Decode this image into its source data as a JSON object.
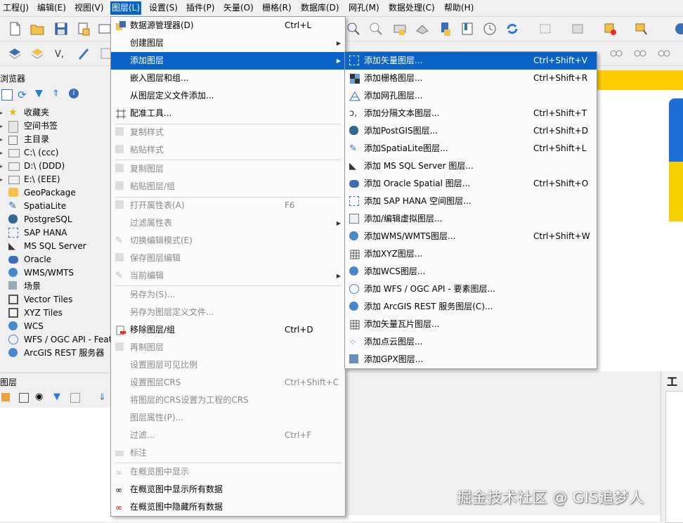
{
  "menubar": [
    "工程(J)",
    "编辑(E)",
    "视图(V)",
    "图层(L)",
    "设置(S)",
    "插件(P)",
    "矢量(O)",
    "栅格(R)",
    "数据库(D)",
    "网孔(M)",
    "数据处理(C)",
    "帮助(H)"
  ],
  "browser": {
    "title": "浏览器",
    "items": [
      "收藏夹",
      "空间书签",
      "主目录",
      "C:\\ (ccc)",
      "D:\\ (DDD)",
      "E:\\ (EEE)",
      "GeoPackage",
      "SpatiaLite",
      "PostgreSQL",
      "SAP HANA",
      "MS SQL Server",
      "Oracle",
      "WMS/WMTS",
      "场景",
      "Vector Tiles",
      "XYZ Tiles",
      "WCS",
      "WFS / OGC API - Feat",
      "ArcGIS REST 服务器"
    ]
  },
  "layers_panel": {
    "title": "图层"
  },
  "right_panel": {
    "title_partial": "工程"
  },
  "layer_menu": {
    "items": [
      {
        "label": "数据源管理器(D)",
        "shortcut": "Ctrl+L"
      },
      {
        "label": "创建图层"
      },
      {
        "label": "添加图层"
      },
      {
        "label": "嵌入图层和组..."
      },
      {
        "label": "从图层定义文件添加..."
      },
      {
        "label": "配准工具..."
      },
      {
        "label": "复制样式"
      },
      {
        "label": "粘贴样式"
      },
      {
        "label": "复制图层"
      },
      {
        "label": "粘贴图层/组"
      },
      {
        "label": "打开属性表(A)",
        "shortcut": "F6"
      },
      {
        "label": "过滤属性表"
      },
      {
        "label": "切换编辑模式(E)"
      },
      {
        "label": "保存图层编辑"
      },
      {
        "label": "当前编辑"
      },
      {
        "label": "另存为(S)..."
      },
      {
        "label": "另存为图层定义文件..."
      },
      {
        "label": "移除图层/组",
        "shortcut": "Ctrl+D"
      },
      {
        "label": "再制图层"
      },
      {
        "label": "设置图层可见比例"
      },
      {
        "label": "设置图层CRS",
        "shortcut": "Ctrl+Shift+C"
      },
      {
        "label": "将图层的CRS设置为工程的CRS"
      },
      {
        "label": "图层属性(P)..."
      },
      {
        "label": "过滤...",
        "shortcut": "Ctrl+F"
      },
      {
        "label": "标注"
      },
      {
        "label": "在概览图中显示"
      },
      {
        "label": "在概览图中显示所有数据"
      },
      {
        "label": "在概览图中隐藏所有数据"
      }
    ]
  },
  "add_layer_menu": {
    "items": [
      {
        "label": "添加矢量图层...",
        "shortcut": "Ctrl+Shift+V"
      },
      {
        "label": "添加栅格图层...",
        "shortcut": "Ctrl+Shift+R"
      },
      {
        "label": "添加网孔图层..."
      },
      {
        "label": "添加分隔文本图层...",
        "shortcut": "Ctrl+Shift+T"
      },
      {
        "label": "添加PostGIS图层...",
        "shortcut": "Ctrl+Shift+D"
      },
      {
        "label": "添加SpatiaLite图层...",
        "shortcut": "Ctrl+Shift+L"
      },
      {
        "label": "添加 MS SQL Server 图层..."
      },
      {
        "label": "添加 Oracle Spatial 图层...",
        "shortcut": "Ctrl+Shift+O"
      },
      {
        "label": "添加 SAP HANA 空间图层..."
      },
      {
        "label": "添加/编辑虚拟图层..."
      },
      {
        "label": "添加WMS/WMTS图层...",
        "shortcut": "Ctrl+Shift+W"
      },
      {
        "label": "添加XYZ图层..."
      },
      {
        "label": "添加WCS图层..."
      },
      {
        "label": "添加 WFS / OGC API - 要素图层..."
      },
      {
        "label": "添加 ArcGIS REST 服务图层(C)..."
      },
      {
        "label": "添加矢量瓦片图层..."
      },
      {
        "label": "添加点云图层..."
      },
      {
        "label": "添加GPX图层..."
      }
    ]
  },
  "watermark": "掘金技术社区 @ GIS追梦人"
}
